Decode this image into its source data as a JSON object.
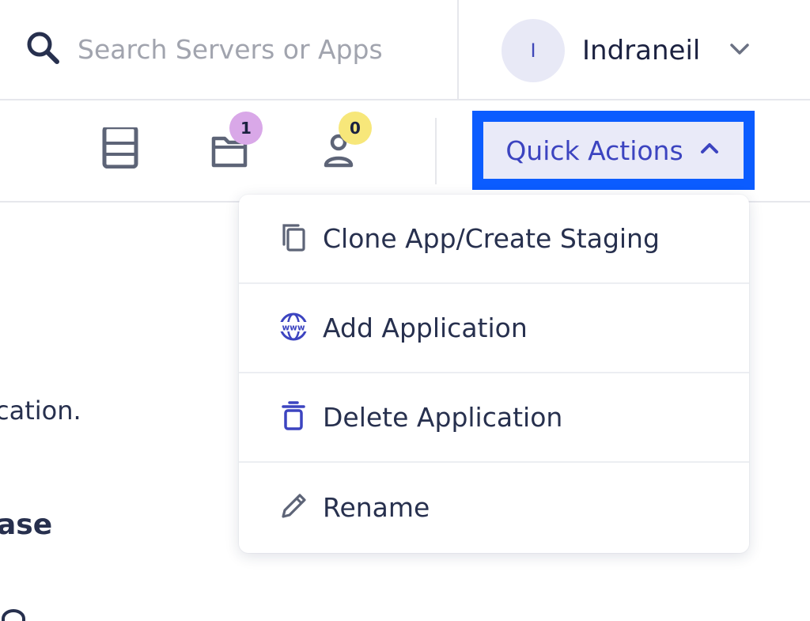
{
  "search": {
    "placeholder": "Search Servers or Apps",
    "icon": "search-icon"
  },
  "user": {
    "avatar_initial": "I",
    "name": "Indraneil",
    "icon": "chevron-down-icon"
  },
  "toolbar": {
    "servers_icon": "server-icon",
    "apps_icon": "folder-icon",
    "apps_count": "1",
    "team_icon": "user-icon",
    "team_count": "0",
    "quick_actions_label": "Quick Actions",
    "quick_actions_icon": "chevron-up-icon"
  },
  "background": {
    "text_line_1": "cation.",
    "text_line_2": "ase"
  },
  "quick_actions_menu": {
    "items": [
      {
        "label": "Clone App/Create Staging",
        "icon": "copy-icon"
      },
      {
        "label": "Add Application",
        "icon": "www-globe-icon"
      },
      {
        "label": "Delete Application",
        "icon": "trash-icon"
      },
      {
        "label": "Rename",
        "icon": "pencil-icon"
      }
    ]
  },
  "colors": {
    "accent": "#3c44c0",
    "highlight_border": "#0b5cff",
    "badge_apps": "#d9a8e8",
    "badge_team": "#f7e77a",
    "text": "#27304e",
    "placeholder": "#a1a4ae"
  }
}
